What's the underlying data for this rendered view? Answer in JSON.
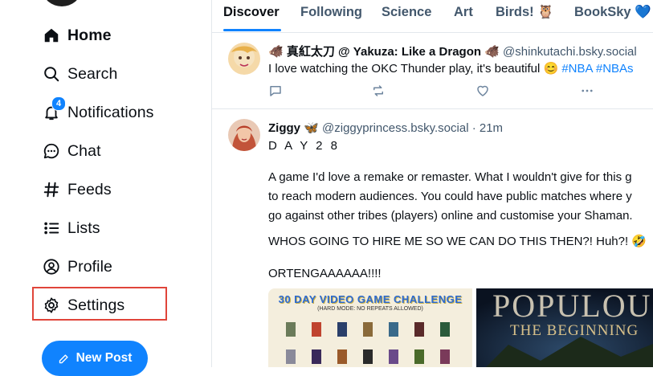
{
  "sidebar": {
    "nav": [
      {
        "label": "Home",
        "icon": "home-icon"
      },
      {
        "label": "Search",
        "icon": "search-icon"
      },
      {
        "label": "Notifications",
        "icon": "bell-icon",
        "badge": "4"
      },
      {
        "label": "Chat",
        "icon": "chat-bubble-icon"
      },
      {
        "label": "Feeds",
        "icon": "hash-icon"
      },
      {
        "label": "Lists",
        "icon": "list-icon"
      },
      {
        "label": "Profile",
        "icon": "user-circle-icon"
      },
      {
        "label": "Settings",
        "icon": "gear-icon"
      }
    ],
    "new_post_label": "New Post"
  },
  "tabs": [
    {
      "label": "Discover"
    },
    {
      "label": "Following"
    },
    {
      "label": "Science"
    },
    {
      "label": "Art"
    },
    {
      "label": "Birds! 🦉"
    },
    {
      "label": "BookSky 💙"
    }
  ],
  "posts": [
    {
      "author": "🐗 真紅太刀 @ Yakuza: Like a Dragon 🐗",
      "handle": "@shinkutachi.bsky.social",
      "text": "I love watching the OKC Thunder play, it's beautiful 😊",
      "hashtags": "#NBA #NBAs"
    },
    {
      "author": "Ziggy 🦋",
      "handle": "@ziggyprincess.bsky.social",
      "time": "· 21m",
      "day": "D A Y 2 8",
      "lines": [
        "A game I'd love a remake or remaster. What I wouldn't give for this g",
        "to reach modern audiences. You could have public matches where y",
        "go against other tribes (players) online and customise your Shaman."
      ],
      "shout": "WHOS GOING TO HIRE ME SO WE CAN DO THIS THEN?! Huh?! 🤣",
      "ortenga": "ORTENGAAAAAA!!!!",
      "image1_title": "30 DAY VIDEO GAME CHALLENGE",
      "image1_sub": "(HARD MODE: NO REPEATS ALLOWED)",
      "image2_title": "POPULOUS",
      "image2_sub": "THE BEGINNING"
    }
  ],
  "colors": {
    "accent": "#1083fe",
    "highlight": "#e0453a",
    "text": "#0b0f14",
    "muted": "#42576c"
  }
}
